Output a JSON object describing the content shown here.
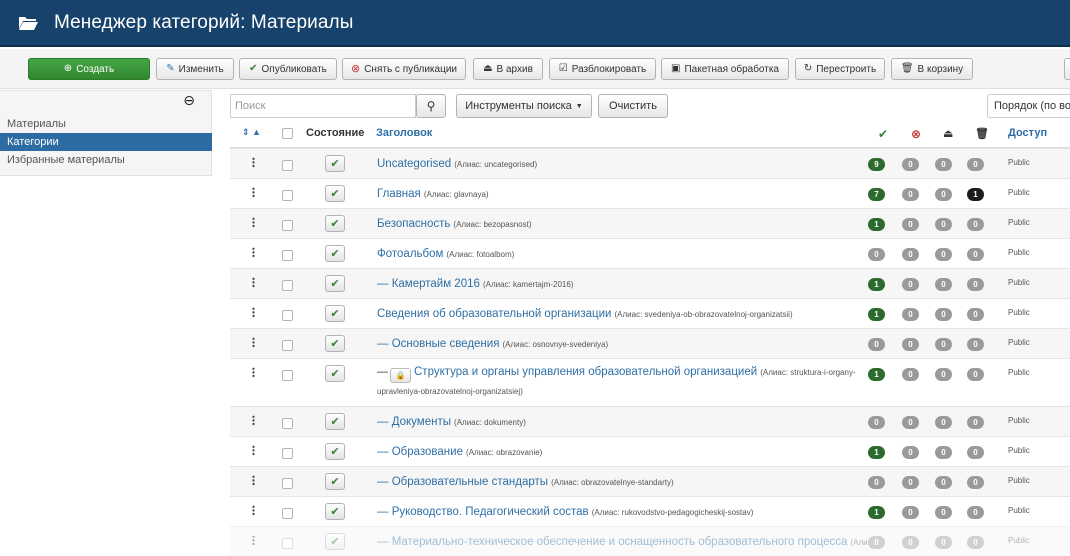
{
  "header": {
    "title": "Менеджер категорий: Материалы"
  },
  "toolbar": {
    "create": "Создать",
    "edit": "Изменить",
    "publish": "Опубликовать",
    "unpublish": "Снять с публикации",
    "archive": "В архив",
    "checkin": "Разблокировать",
    "batch": "Пакетная обработка",
    "rebuild": "Перестроить",
    "trash": "В корзину"
  },
  "sidebar": {
    "items": [
      {
        "label": "Материалы"
      },
      {
        "label": "Категории"
      },
      {
        "label": "Избранные материалы"
      }
    ]
  },
  "filters": {
    "search_placeholder": "Поиск",
    "search_tools": "Инструменты поиска",
    "clear": "Очистить",
    "order": "Порядок (по во"
  },
  "table": {
    "headers": {
      "state": "Состояние",
      "title": "Заголовок",
      "access": "Доступ"
    },
    "rows": [
      {
        "title": "Uncategorised",
        "alias": "(Алиас: uncategorised)",
        "pub": "9",
        "unpub": "0",
        "arch": "0",
        "trash": "0",
        "access": "Public"
      },
      {
        "title": "Главная",
        "alias": "(Алиас: glavnaya)",
        "pub": "7",
        "unpub": "0",
        "arch": "0",
        "trash": "1",
        "access": "Public"
      },
      {
        "title": "Безопасность",
        "alias": "(Алиас: bezopasnost)",
        "pub": "1",
        "unpub": "0",
        "arch": "0",
        "trash": "0",
        "access": "Public"
      },
      {
        "title": "Фотоальбом",
        "alias": "(Алиас: fotoalbom)",
        "pub": "0",
        "unpub": "0",
        "arch": "0",
        "trash": "0",
        "access": "Public"
      },
      {
        "title": "— Камертайм 2016",
        "alias": "(Алиас: kamertajm-2016)",
        "pub": "1",
        "unpub": "0",
        "arch": "0",
        "trash": "0",
        "access": "Public"
      },
      {
        "title": "Сведения об образовательной организации",
        "alias": "(Алиас: svedeniya-ob-obrazovatelnoj-organizatsii)",
        "pub": "1",
        "unpub": "0",
        "arch": "0",
        "trash": "0",
        "access": "Public"
      },
      {
        "title": "— Основные сведения",
        "alias": "(Алиас: osnovnye-svedeniya)",
        "pub": "0",
        "unpub": "0",
        "arch": "0",
        "trash": "0",
        "access": "Public"
      },
      {
        "title": "Структура и органы управления образовательной организацией",
        "alias": "(Алиас: struktura-i-organy-upravleniya-obrazovatelnoj-organizatsiej)",
        "pub": "1",
        "unpub": "0",
        "arch": "0",
        "trash": "0",
        "access": "Public"
      },
      {
        "title": "— Документы",
        "alias": "(Алиас: dokumenty)",
        "pub": "0",
        "unpub": "0",
        "arch": "0",
        "trash": "0",
        "access": "Public"
      },
      {
        "title": "— Образование",
        "alias": "(Алиас: obrazovanie)",
        "pub": "1",
        "unpub": "0",
        "arch": "0",
        "trash": "0",
        "access": "Public"
      },
      {
        "title": "— Образовательные стандарты",
        "alias": "(Алиас: obrazovatelnye-standarty)",
        "pub": "0",
        "unpub": "0",
        "arch": "0",
        "trash": "0",
        "access": "Public"
      },
      {
        "title": "— Руководство. Педагогический состав",
        "alias": "(Алиас: rukovodstvo-pedagogicheskij-sostav)",
        "pub": "1",
        "unpub": "0",
        "arch": "0",
        "trash": "0",
        "access": "Public"
      },
      {
        "title": "— Материально-техническое обеспечение и оснащенность образовательного процесса",
        "alias": "(Алиас:",
        "pub": "0",
        "unpub": "0",
        "arch": "0",
        "trash": "0",
        "access": "Public"
      }
    ]
  }
}
